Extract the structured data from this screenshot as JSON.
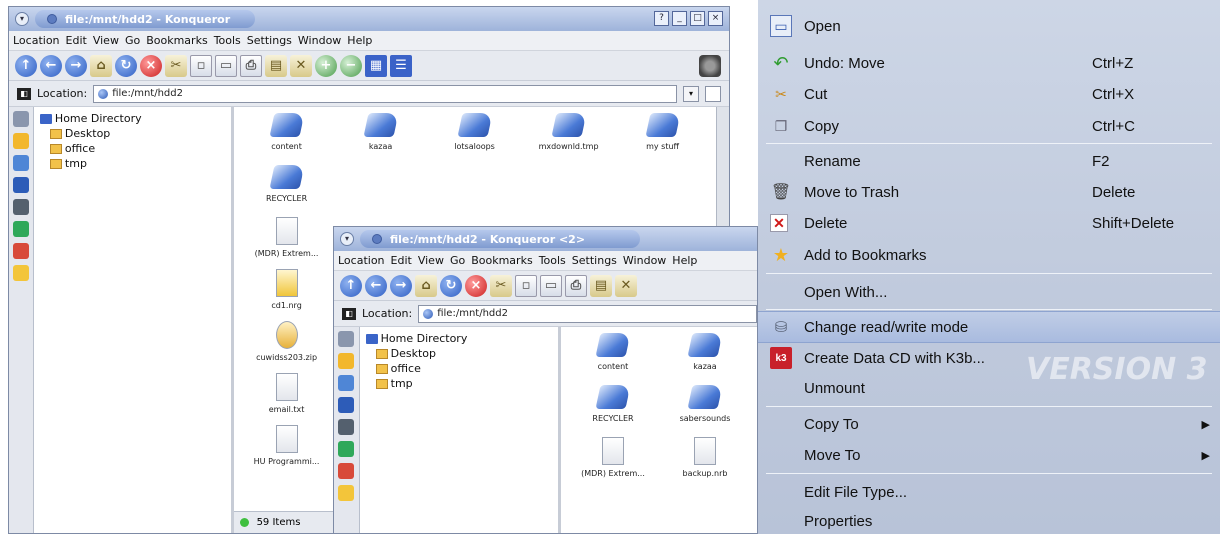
{
  "win1": {
    "title": "file:/mnt/hdd2 - Konqueror",
    "menu": [
      "Location",
      "Edit",
      "View",
      "Go",
      "Bookmarks",
      "Tools",
      "Settings",
      "Window",
      "Help"
    ],
    "location_label": "Location:",
    "location_value": "file:/mnt/hdd2",
    "tree": {
      "root": "Home Directory",
      "children": [
        "Desktop",
        "office",
        "tmp"
      ]
    },
    "icons": [
      {
        "label": "content",
        "kind": "folder"
      },
      {
        "label": "kazaa",
        "kind": "folder"
      },
      {
        "label": "lotsaloops",
        "kind": "folder"
      },
      {
        "label": "mxdownld.tmp",
        "kind": "folder"
      },
      {
        "label": "my stuff",
        "kind": "folder"
      },
      {
        "label": "RECYCLER",
        "kind": "folder"
      },
      {
        "label": "(MDR) Extrem...",
        "kind": "doc"
      },
      {
        "label": "cd1.nrg",
        "kind": "doc"
      },
      {
        "label": "cuwidss203.zip",
        "kind": "doc"
      },
      {
        "label": "email.txt",
        "kind": "doc"
      },
      {
        "label": "HU Programmi...",
        "kind": "doc"
      }
    ],
    "status": "59 Items"
  },
  "win2": {
    "title": "file:/mnt/hdd2 - Konqueror <2>",
    "menu": [
      "Location",
      "Edit",
      "View",
      "Go",
      "Bookmarks",
      "Tools",
      "Settings",
      "Window",
      "Help"
    ],
    "location_label": "Location:",
    "location_value": "file:/mnt/hdd2",
    "tree": {
      "root": "Home Directory",
      "children": [
        "Desktop",
        "office",
        "tmp"
      ]
    },
    "icons": [
      {
        "label": "content",
        "kind": "folder"
      },
      {
        "label": "kazaa",
        "kind": "folder"
      },
      {
        "label": "RECYCLER",
        "kind": "folder"
      },
      {
        "label": "sabersounds",
        "kind": "folder"
      },
      {
        "label": "(MDR) Extrem...",
        "kind": "doc"
      },
      {
        "label": "backup.nrb",
        "kind": "doc"
      }
    ]
  },
  "context_menu": {
    "items": [
      {
        "label": "Open",
        "shortcut": "",
        "icon": "open-icon"
      },
      {
        "label": "Undo: Move",
        "shortcut": "Ctrl+Z",
        "icon": "undo-icon"
      },
      {
        "label": "Cut",
        "shortcut": "Ctrl+X",
        "icon": "cut-icon"
      },
      {
        "label": "Copy",
        "shortcut": "Ctrl+C",
        "icon": "copy-icon"
      },
      {
        "label": "Rename",
        "shortcut": "F2",
        "icon": ""
      },
      {
        "label": "Move to Trash",
        "shortcut": "Delete",
        "icon": "trash-icon"
      },
      {
        "label": "Delete",
        "shortcut": "Shift+Delete",
        "icon": "delete-icon"
      },
      {
        "label": "Add to Bookmarks",
        "shortcut": "",
        "icon": "bookmark-icon"
      },
      {
        "label": "Open With...",
        "shortcut": "",
        "icon": ""
      },
      {
        "label": "Change read/write mode",
        "shortcut": "",
        "icon": "disk-icon"
      },
      {
        "label": "Create Data CD with K3b...",
        "shortcut": "",
        "icon": "k3b-icon"
      },
      {
        "label": "Unmount",
        "shortcut": "",
        "icon": ""
      },
      {
        "label": "Copy To",
        "shortcut": "",
        "icon": ""
      },
      {
        "label": "Move To",
        "shortcut": "",
        "icon": ""
      },
      {
        "label": "Edit File Type...",
        "shortcut": "",
        "icon": ""
      },
      {
        "label": "Properties",
        "shortcut": "",
        "icon": ""
      }
    ],
    "highlighted_index": 9,
    "colors": {
      "highlight": "#a9bbdf",
      "background": "#c5cfe2"
    }
  }
}
